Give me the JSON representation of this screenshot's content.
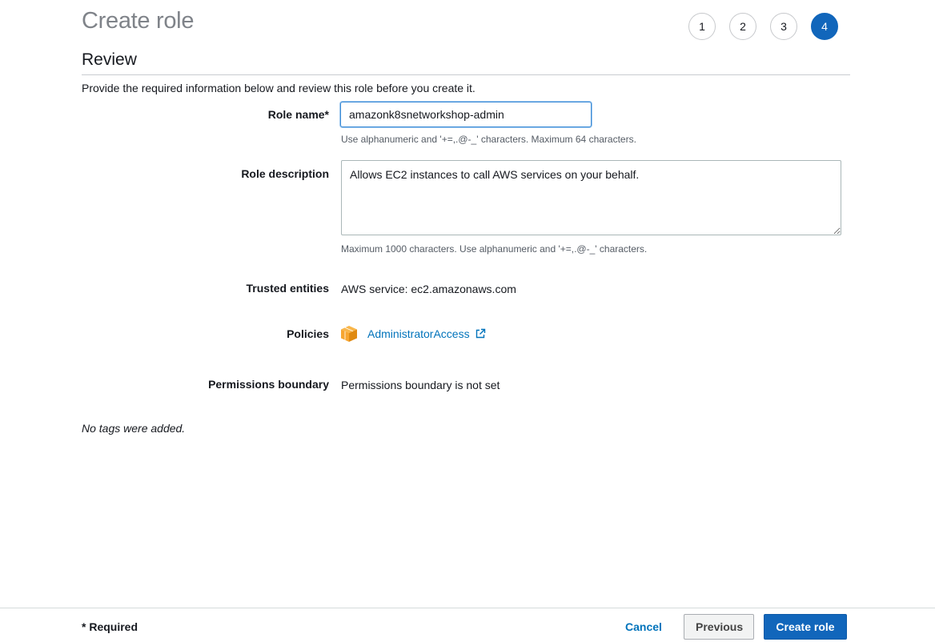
{
  "header": {
    "title": "Create role",
    "steps": [
      "1",
      "2",
      "3",
      "4"
    ],
    "active_step": "4"
  },
  "review": {
    "section_title": "Review",
    "intro": "Provide the required information below and review this role before you create it.",
    "role_name": {
      "label": "Role name*",
      "value": "amazonk8snetworkshop-admin",
      "hint": "Use alphanumeric and '+=,.@-_' characters. Maximum 64 characters."
    },
    "role_description": {
      "label": "Role description",
      "value": "Allows EC2 instances to call AWS services on your behalf.",
      "hint": "Maximum 1000 characters. Use alphanumeric and '+=,.@-_' characters."
    },
    "trusted_entities": {
      "label": "Trusted entities",
      "value": "AWS service: ec2.amazonaws.com"
    },
    "policies": {
      "label": "Policies",
      "items": [
        {
          "name": "AdministratorAccess",
          "icon": "policy-cube-icon",
          "link_icon": "external-link-icon"
        }
      ]
    },
    "permissions_boundary": {
      "label": "Permissions boundary",
      "value": "Permissions boundary is not set"
    },
    "tags_note": "No tags were added."
  },
  "footer": {
    "required_note": "* Required",
    "cancel_label": "Cancel",
    "previous_label": "Previous",
    "create_label": "Create role"
  },
  "colors": {
    "primary": "#1166bb",
    "link": "#0073bb",
    "policy_icon": "#f7a630"
  }
}
